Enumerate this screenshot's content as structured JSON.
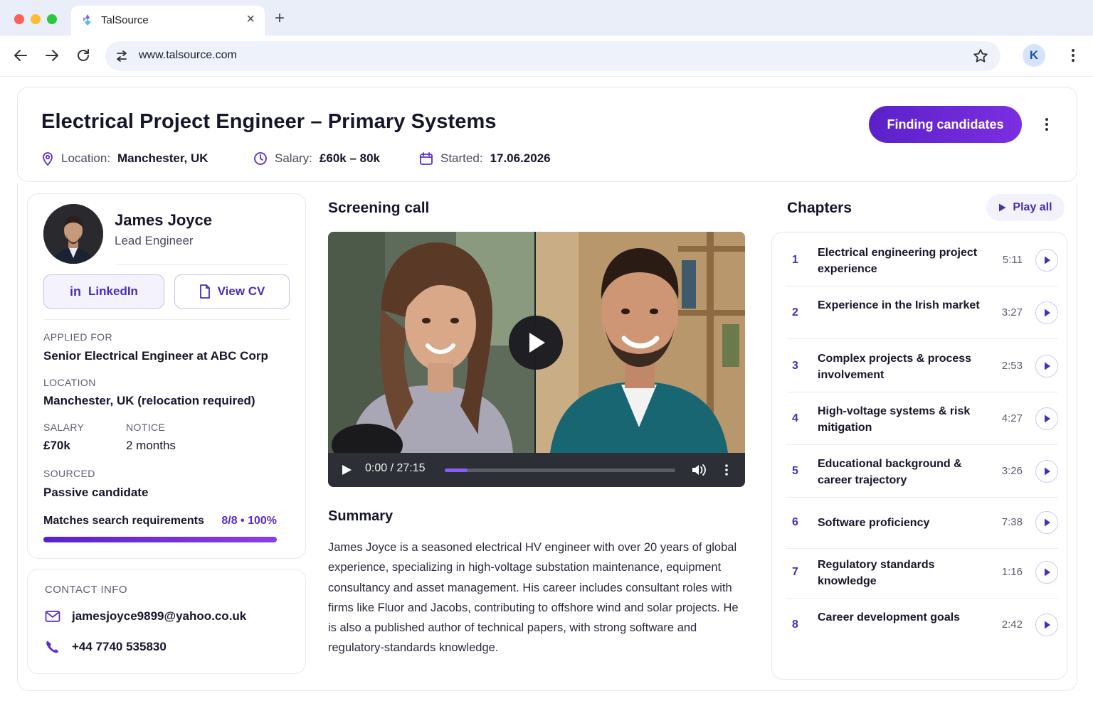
{
  "browser": {
    "tab_title": "TalSource",
    "url": "www.talsource.com",
    "profile_initial": "K"
  },
  "job": {
    "title": "Electrical Project Engineer – Primary Systems",
    "location_label": "Location:",
    "location_value": "Manchester, UK",
    "salary_label": "Salary:",
    "salary_value": "£60k – 80k",
    "started_label": "Started:",
    "started_value": "17.06.2026",
    "status_button": "Finding candidates"
  },
  "candidate": {
    "name": "James Joyce",
    "role": "Lead Engineer",
    "linkedin_label": "LinkedIn",
    "cv_label": "View CV",
    "applied_for_label": "APPLIED FOR",
    "applied_for_value": "Senior Electrical Engineer at ABC Corp",
    "location_label": "LOCATION",
    "location_value": "Manchester, UK (relocation required)",
    "salary_label": "SALARY",
    "salary_value": "£70k",
    "notice_label": "NOTICE",
    "notice_value": "2 months",
    "sourced_label": "SOURCED",
    "sourced_value": "Passive candidate",
    "match_label": "Matches search requirements",
    "match_value": "8/8 • 100%",
    "match_fraction": 1.0
  },
  "contact": {
    "heading": "CONTACT INFO",
    "email": "jamesjoyce9899@yahoo.co.uk",
    "phone": "+44 7740 535830"
  },
  "screening": {
    "heading": "Screening call",
    "time": "0:00 / 27:15",
    "progress_fraction": 0.1,
    "summary_heading": "Summary",
    "summary": "James Joyce is a seasoned electrical HV engineer with over 20 years of global experience, specializing in high-voltage substation maintenance, equipment consultancy and asset management. His career includes consultant roles with firms like Fluor and Jacobs, contributing to offshore wind and solar projects. He is also a published author of technical papers, with strong software and regulatory-standards knowledge."
  },
  "chapters": {
    "heading": "Chapters",
    "play_all": "Play all",
    "items": [
      {
        "num": "1",
        "title": "Electrical engineering project experience",
        "duration": "5:11"
      },
      {
        "num": "2",
        "title": "Experience in the Irish market",
        "duration": "3:27"
      },
      {
        "num": "3",
        "title": "Complex projects & process involvement",
        "duration": "2:53"
      },
      {
        "num": "4",
        "title": "High-voltage systems & risk mitigation",
        "duration": "4:27"
      },
      {
        "num": "5",
        "title": "Educational background & career trajectory",
        "duration": "3:26"
      },
      {
        "num": "6",
        "title": "Software proficiency",
        "duration": "7:38"
      },
      {
        "num": "7",
        "title": "Regulatory standards knowledge",
        "duration": "1:16"
      },
      {
        "num": "8",
        "title": "Career development goals",
        "duration": "2:42"
      }
    ]
  },
  "colors": {
    "accent": "#5b21c9",
    "accent_text": "#4b2bb8"
  }
}
